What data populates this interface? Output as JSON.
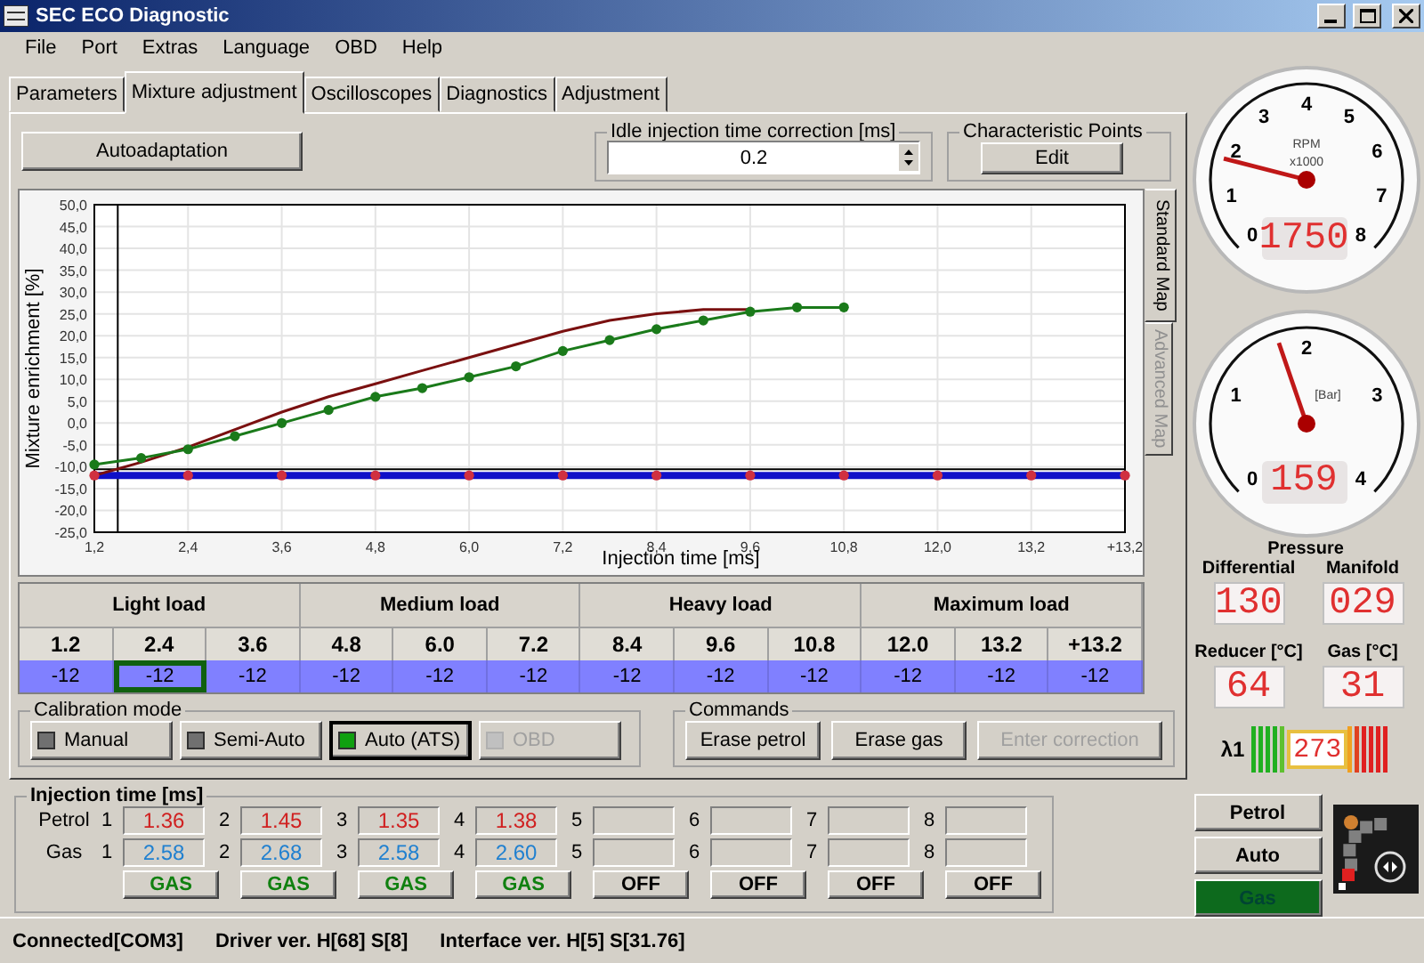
{
  "window": {
    "title": "SEC ECO Diagnostic"
  },
  "menu": [
    "File",
    "Port",
    "Extras",
    "Language",
    "OBD",
    "Help"
  ],
  "tabs": [
    {
      "label": "Parameters",
      "selected": false
    },
    {
      "label": "Mixture adjustment",
      "selected": true
    },
    {
      "label": "Oscilloscopes",
      "selected": false
    },
    {
      "label": "Diagnostics",
      "selected": false
    },
    {
      "label": "Adjustment",
      "selected": false
    }
  ],
  "autoadaptation_button": "Autoadaptation",
  "idle_correction": {
    "label": "Idle injection time correction [ms]",
    "value": "0.2"
  },
  "characteristic_points": {
    "label": "Characteristic Points",
    "button": "Edit"
  },
  "chart": {
    "overflow_tick_label": "+13,2",
    "chart_data": {
      "type": "line",
      "xlabel": "Injection time [ms]",
      "ylabel": "Mixture enrichment [%]",
      "x": [
        1.2,
        1.8,
        2.4,
        3.0,
        3.6,
        4.2,
        4.8,
        5.4,
        6.0,
        6.6,
        7.2,
        7.8,
        8.4,
        9.0,
        9.6,
        10.2,
        10.8,
        11.4,
        12.0,
        12.6,
        13.2,
        13.8,
        14.4
      ],
      "series": [
        {
          "color": "#1010c8",
          "marker": "o",
          "values": [
            -12,
            -12,
            -12,
            -12,
            -12,
            -12,
            -12,
            -12,
            -12,
            -12,
            -12,
            -12,
            -12,
            -12,
            -12,
            -12,
            -12,
            -12,
            -12,
            -12,
            -12,
            -12,
            -12
          ]
        },
        {
          "color": "#7a1010",
          "values": [
            -12,
            -9,
            -5.5,
            -1.5,
            2.5,
            6,
            9,
            12,
            15,
            18,
            21,
            23.5,
            25,
            26,
            26,
            null,
            null,
            null,
            null,
            null,
            null,
            null,
            null
          ]
        },
        {
          "color": "#1a7a1a",
          "marker": "o",
          "values": [
            -9.5,
            -8,
            -6,
            -3,
            0,
            3,
            6,
            8,
            10.5,
            13,
            16.5,
            19,
            21.5,
            23.5,
            25.5,
            26.5,
            26.5,
            null,
            null,
            null,
            null,
            null,
            null
          ]
        }
      ],
      "xlim": [
        1.2,
        14.4
      ],
      "ylim": [
        -25,
        50
      ],
      "grid": true,
      "ref_lines": [
        {
          "axis": "x",
          "value": 1.5,
          "color": "#000000"
        },
        {
          "axis": "y",
          "value": -10.6,
          "color": "#000000"
        }
      ],
      "xticks": [
        {
          "value": 1.2,
          "label": "1,2"
        },
        {
          "value": 2.4,
          "label": "2,4"
        },
        {
          "value": 3.6,
          "label": "3,6"
        },
        {
          "value": 4.8,
          "label": "4,8"
        },
        {
          "value": 6.0,
          "label": "6,0"
        },
        {
          "value": 7.2,
          "label": "7,2"
        },
        {
          "value": 8.4,
          "label": "8,4"
        },
        {
          "value": 9.6,
          "label": "9,6"
        },
        {
          "value": 10.8,
          "label": "10,8"
        },
        {
          "value": 12.0,
          "label": "12,0"
        },
        {
          "value": 13.2,
          "label": "13,2"
        }
      ],
      "yticks": [
        {
          "value": 50,
          "label": "50,0"
        },
        {
          "value": 45,
          "label": "45,0"
        },
        {
          "value": 40,
          "label": "40,0"
        },
        {
          "value": 35,
          "label": "35,0"
        },
        {
          "value": 30,
          "label": "30,0"
        },
        {
          "value": 25,
          "label": "25,0"
        },
        {
          "value": 20,
          "label": "20,0"
        },
        {
          "value": 15,
          "label": "15,0"
        },
        {
          "value": 10,
          "label": "10,0"
        },
        {
          "value": 5,
          "label": "5,0"
        },
        {
          "value": 0,
          "label": "0,0"
        },
        {
          "value": -5,
          "label": "-5,0"
        },
        {
          "value": -10,
          "label": "-10,0"
        },
        {
          "value": -15,
          "label": "-15,0"
        },
        {
          "value": -20,
          "label": "-20,0"
        },
        {
          "value": -25,
          "label": "-25,0"
        }
      ]
    }
  },
  "map_tabs": [
    {
      "label": "Standard Map",
      "selected": true
    },
    {
      "label": "Advanced Map",
      "selected": false
    }
  ],
  "load_table": {
    "groups": [
      "Light load",
      "Medium load",
      "Heavy load",
      "Maximum load"
    ],
    "columns": [
      "1.2",
      "2.4",
      "3.6",
      "4.8",
      "6.0",
      "7.2",
      "8.4",
      "9.6",
      "10.8",
      "12.0",
      "13.2",
      "+13.2"
    ],
    "values": [
      {
        "text": "-12",
        "selected": false
      },
      {
        "text": "-12",
        "selected": true
      },
      {
        "text": "-12",
        "selected": false
      },
      {
        "text": "-12",
        "selected": false
      },
      {
        "text": "-12",
        "selected": false
      },
      {
        "text": "-12",
        "selected": false
      },
      {
        "text": "-12",
        "selected": false
      },
      {
        "text": "-12",
        "selected": false
      },
      {
        "text": "-12",
        "selected": false
      },
      {
        "text": "-12",
        "selected": false
      },
      {
        "text": "-12",
        "selected": false
      },
      {
        "text": "-12",
        "selected": false
      }
    ]
  },
  "calibration_mode": {
    "label": "Calibration mode",
    "options": [
      {
        "label": "Manual",
        "selected": false,
        "disabled": false
      },
      {
        "label": "Semi-Auto",
        "selected": false,
        "disabled": false
      },
      {
        "label": "Auto (ATS)",
        "selected": true,
        "disabled": false
      },
      {
        "label": "OBD",
        "selected": false,
        "disabled": true
      }
    ]
  },
  "commands": {
    "label": "Commands",
    "buttons": [
      {
        "label": "Erase petrol",
        "disabled": false
      },
      {
        "label": "Erase gas",
        "disabled": false
      },
      {
        "label": "Enter correction",
        "disabled": true
      }
    ]
  },
  "injection_time": {
    "label": "Injection time [ms]",
    "rows": [
      {
        "label": "Petrol",
        "kind": "petrol",
        "cells": [
          {
            "index": "1",
            "value": "1.36"
          },
          {
            "index": "2",
            "value": "1.45"
          },
          {
            "index": "3",
            "value": "1.35"
          },
          {
            "index": "4",
            "value": "1.38"
          },
          {
            "index": "5"
          },
          {
            "index": "6"
          },
          {
            "index": "7"
          },
          {
            "index": "8"
          }
        ]
      },
      {
        "label": "Gas",
        "kind": "gas",
        "cells": [
          {
            "index": "1",
            "value": "2.58"
          },
          {
            "index": "2",
            "value": "2.68"
          },
          {
            "index": "3",
            "value": "2.58"
          },
          {
            "index": "4",
            "value": "2.60"
          },
          {
            "index": "5"
          },
          {
            "index": "6"
          },
          {
            "index": "7"
          },
          {
            "index": "8"
          }
        ]
      }
    ],
    "switches": [
      {
        "label": "GAS",
        "kind": "gas"
      },
      {
        "label": "GAS",
        "kind": "gas"
      },
      {
        "label": "GAS",
        "kind": "gas"
      },
      {
        "label": "GAS",
        "kind": "gas"
      },
      {
        "label": "OFF",
        "kind": "off"
      },
      {
        "label": "OFF",
        "kind": "off"
      },
      {
        "label": "OFF",
        "kind": "off"
      },
      {
        "label": "OFF",
        "kind": "off"
      }
    ]
  },
  "gauges": [
    {
      "ticks": [
        "0",
        "1",
        "2",
        "3",
        "4",
        "5",
        "6",
        "7",
        "8"
      ],
      "unit": "RPM",
      "scale": "x1000",
      "level": 0.22,
      "reading": "1750"
    },
    {
      "ticks": [
        "0",
        "1",
        "2",
        "3",
        "4"
      ],
      "unit": "[Bar]",
      "level": 0.43,
      "reading": "159"
    }
  ],
  "pressure": {
    "title": "Pressure",
    "readings": [
      {
        "label": "Differential",
        "value": "130"
      },
      {
        "label": "Manifold",
        "value": "029"
      }
    ]
  },
  "temperatures": [
    {
      "label": "Reducer [°C]",
      "value": "64"
    },
    {
      "label": "Gas [°C]",
      "value": "31"
    }
  ],
  "lambda": {
    "label": "λ1",
    "reading": "273"
  },
  "fuel_buttons": [
    {
      "label": "Petrol",
      "selected": false
    },
    {
      "label": "Auto",
      "selected": false
    },
    {
      "label": "Gas",
      "selected": true
    }
  ],
  "status_bar": [
    "Connected[COM3]",
    "Driver ver. H[68] S[8]",
    "Interface ver. H[5] S[31.76]"
  ]
}
